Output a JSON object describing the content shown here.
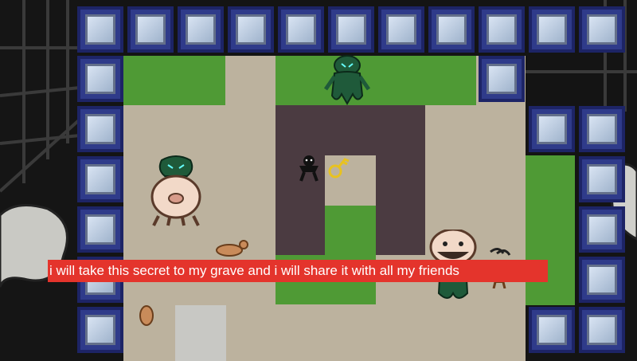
{
  "caption": {
    "text": "i will take this secret to my grave and i will share it with all my friends"
  },
  "colors": {
    "floor": "#bcb29e",
    "grass": "#4f9a35",
    "pit": "#4b3b41",
    "wall_tile": "#2f3b8a",
    "caption_bg": "#e4342c"
  },
  "sprites": [
    "green-ghost-monster",
    "player-shadow-figure",
    "golden-key-icon",
    "pig-monster",
    "mustache-pig-monster",
    "small-creature",
    "orange-critter"
  ]
}
